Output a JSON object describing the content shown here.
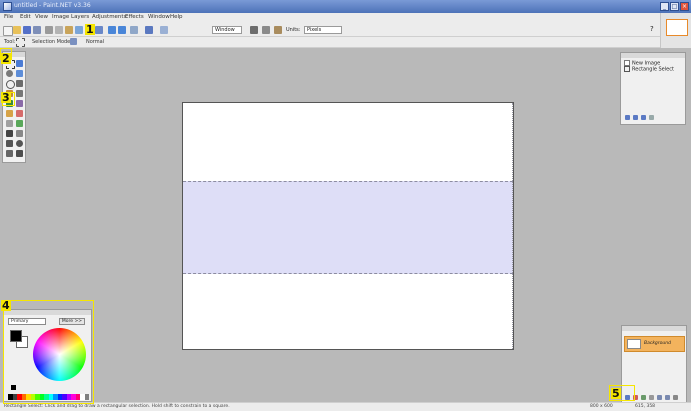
{
  "window": {
    "title": "untitled - Paint.NET v3.36",
    "controls": [
      "_",
      "□",
      "×"
    ]
  },
  "menu": [
    "File",
    "Edit",
    "View",
    "Image",
    "Layers",
    "Adjustments",
    "Effects",
    "Window",
    "Help"
  ],
  "toolbar": {
    "zoom_value": "Window",
    "units_label": "Units:",
    "units_value": "Pixels",
    "help_glyph": "?"
  },
  "options_bar": {
    "tool_label": "Tool:",
    "selection_mode_label": "Selection Mode:",
    "selection_mode_value": "Normal"
  },
  "history": {
    "items": [
      "New Image",
      "Rectangle Select"
    ]
  },
  "colors": {
    "mode_value": "Primary",
    "more_button": "More >>",
    "primary_color": "#000000",
    "secondary_color": "#ffffff",
    "palette": [
      "#000000",
      "#404040",
      "#ff0000",
      "#ff6a00",
      "#ffd800",
      "#b6ff00",
      "#4cff00",
      "#00ff21",
      "#00ff90",
      "#00ffff",
      "#0094ff",
      "#0026ff",
      "#4800ff",
      "#b200ff",
      "#ff00dc",
      "#ff006e",
      "#ffffff",
      "#808080"
    ]
  },
  "layers": {
    "items": [
      "Background"
    ]
  },
  "status": {
    "hint": "Rectangle Select: Click and drag to draw a rectangular selection. Hold shift to constrain to a square.",
    "size": "800 x 600",
    "position": "615, 358"
  },
  "callouts": [
    "1",
    "2",
    "3",
    "4",
    "5"
  ],
  "accent_color": "#f5e600"
}
